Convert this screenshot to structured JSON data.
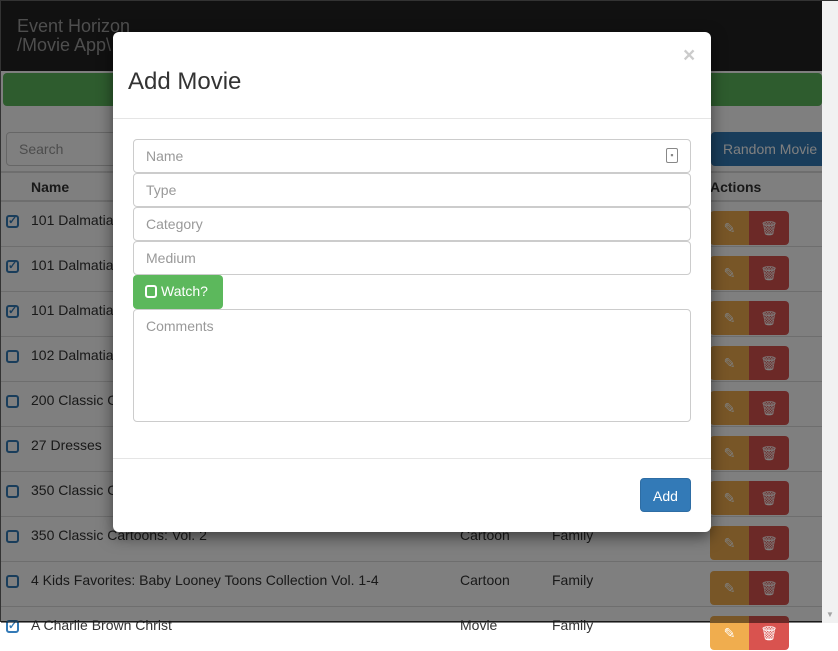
{
  "navbar": {
    "brand_line1": "Event Horizon",
    "brand_line2": "/Movie App\\"
  },
  "colors": {
    "primary": "#337ab7",
    "success": "#5cb85c",
    "warning": "#f0ad4e",
    "danger": "#d9534f"
  },
  "toolbar": {
    "search_placeholder": "Search",
    "random_label": "Random Movie"
  },
  "table": {
    "headers": {
      "name": "Name",
      "actions": "Actions"
    },
    "rows": [
      {
        "name": "101 Dalmatia",
        "type": "",
        "category": "",
        "watched": true
      },
      {
        "name": "101 Dalmatia",
        "type": "",
        "category": "",
        "watched": true
      },
      {
        "name": "101 Dalmatia",
        "type": "",
        "category": "",
        "watched": true
      },
      {
        "name": "102 Dalmatia",
        "type": "",
        "category": "",
        "watched": false
      },
      {
        "name": "200 Classic C",
        "type": "",
        "category": "",
        "watched": false
      },
      {
        "name": "27 Dresses",
        "type": "",
        "category": "",
        "watched": false
      },
      {
        "name": "350 Classic C",
        "type": "",
        "category": "",
        "watched": false
      },
      {
        "name": "350 Classic Cartoons: Vol. 2",
        "type": "Cartoon",
        "category": "Family",
        "watched": false
      },
      {
        "name": "4 Kids Favorites: Baby Looney Toons Collection Vol. 1-4",
        "type": "Cartoon",
        "category": "Family",
        "watched": false
      },
      {
        "name": "A Charlie Brown Christ",
        "type": "Movie",
        "category": "Family",
        "watched": true
      }
    ]
  },
  "modal": {
    "title": "Add Movie",
    "close": "×",
    "name_placeholder": "Name",
    "type_placeholder": "Type",
    "category_placeholder": "Category",
    "medium_placeholder": "Medium",
    "watch_label": "Watch?",
    "watch_checked": false,
    "comments_placeholder": "Comments",
    "add_label": "Add"
  }
}
